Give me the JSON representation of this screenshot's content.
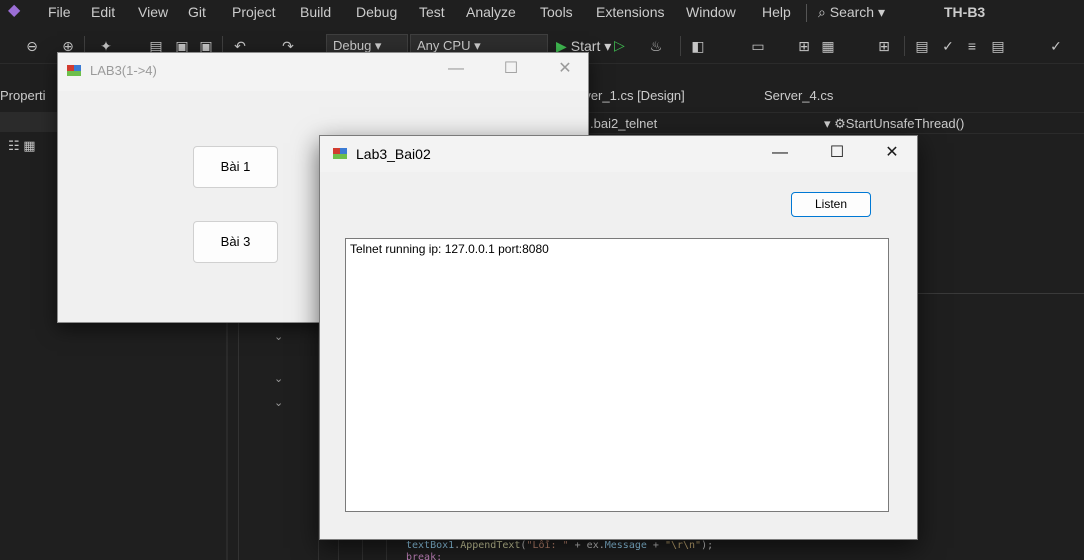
{
  "vs": {
    "menu": [
      "File",
      "Edit",
      "View",
      "Git",
      "Project",
      "Build",
      "Debug",
      "Test",
      "Analyze",
      "Tools",
      "Extensions",
      "Window",
      "Help"
    ],
    "search_label": "Search",
    "solution_name": "TH-B3",
    "toolbar": {
      "config": "Debug",
      "platform": "Any CPU",
      "start_label": "Start"
    },
    "properties_tab": "Properti",
    "tabs": [
      "rver_1.cs [Design]",
      "Server_4.cs"
    ],
    "nav_left": ".bai2_telnet",
    "nav_right": "StartUnsafeThread()",
    "code": {
      "line1_obj": "textBox1",
      "line1_method": "AppendText",
      "line1_str": "\"Lỗi: \"",
      "line1_mid": " + ex.",
      "line1_prop": "Message",
      "line1_plus": " + ",
      "line1_esc": "\"\\r\\n\"",
      "line1_end": ");",
      "line2": "break;"
    }
  },
  "win1": {
    "title": "LAB3(1->4)",
    "button1": "Bài 1",
    "button3": "Bài 3"
  },
  "win2": {
    "title": "Lab3_Bai02",
    "listen_label": "Listen",
    "log_text": "Telnet running ip: 127.0.0.1 port:8080"
  },
  "window_controls": {
    "minimize": "—",
    "maximize": "☐",
    "close": "✕"
  },
  "colors": {
    "vs_background": "#1f1f1f",
    "form_background": "#f0f0f0",
    "accent_blue": "#0078d4",
    "run_green": "#3fb950"
  }
}
